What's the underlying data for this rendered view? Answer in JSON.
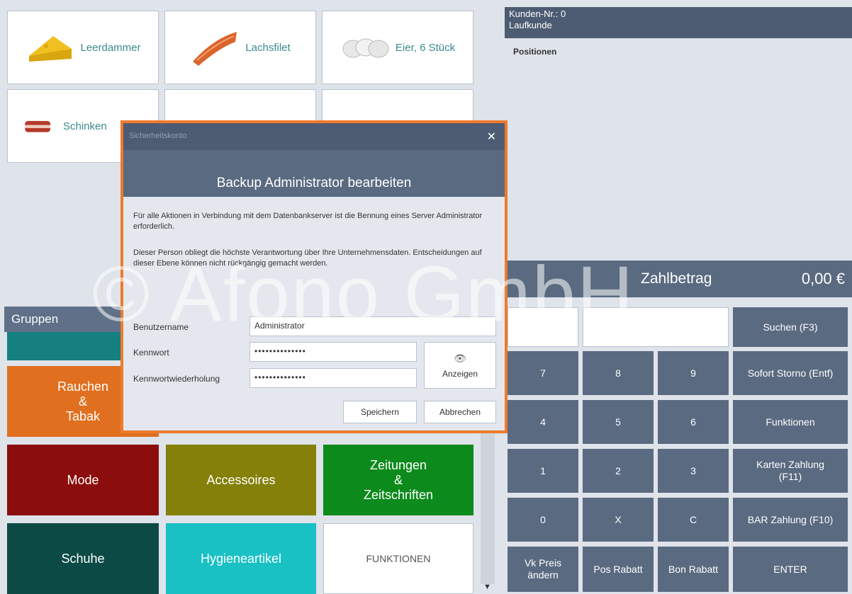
{
  "products": [
    {
      "label": "Leerdammer",
      "icon": "cheese-icon"
    },
    {
      "label": "Lachsfilet",
      "icon": "salmon-icon"
    },
    {
      "label": "Eier, 6 Stück",
      "icon": "eggs-icon"
    },
    {
      "label": "Schinken",
      "icon": "ham-icon"
    }
  ],
  "groups": {
    "header": "Gruppen",
    "items": [
      {
        "label": "Rauchen\n&\nTabak",
        "color": "#e06f1f"
      },
      {
        "label": "Mode",
        "color": "#8b0d0d"
      },
      {
        "label": "Accessoires",
        "color": "#848009"
      },
      {
        "label": "Zeitungen\n&\nZeitschriften",
        "color": "#0d8a1c"
      },
      {
        "label": "Schuhe",
        "color": "#0c4a45"
      },
      {
        "label": "Hygieneartikel",
        "color": "#19c0c4"
      },
      {
        "label": "FUNKTIONEN",
        "color": "#ffffff"
      }
    ]
  },
  "customer": {
    "number": "Kunden-Nr.: 0",
    "name": "Laufkunde"
  },
  "positions_title": "Positionen",
  "payment": {
    "label": "Zahlbetrag",
    "amount": "0,00 €"
  },
  "numpad": {
    "search": "Suchen (F3)",
    "storno": "Sofort Storno (Entf)",
    "functions": "Funktionen",
    "card": "Karten Zahlung\n(F11)",
    "cash": "BAR Zahlung (F10)",
    "enter": "ENTER",
    "keys": [
      "7",
      "8",
      "9",
      "4",
      "5",
      "6",
      "1",
      "2",
      "3",
      "0",
      "X",
      "C"
    ],
    "vk_price": "Vk Preis\nändern",
    "pos_discount": "Pos Rabatt",
    "bon_discount": "Bon Rabatt"
  },
  "watermark": "© Afono GmbH",
  "dialog": {
    "title": "Sicherheitskonto",
    "heading": "Backup Administrator bearbeiten",
    "text1": "Für alle Aktionen in Verbindung mit dem Datenbankserver ist die Bennung eines Server Administrator erforderlich.",
    "text2": "Dieser Person obliegt die höchste Verantwortung über Ihre Unternehmensdaten. Entscheidungen auf dieser Ebene können nicht rückgängig gemacht werden.",
    "username_label": "Benutzername",
    "username_value": "Administrator",
    "password_label": "Kennwort",
    "password_value": "••••••••••••••",
    "repeat_label": "Kennwortwiederholung",
    "repeat_value": "••••••••••••••",
    "show_label": "Anzeigen",
    "save_label": "Speichern",
    "cancel_label": "Abbrechen",
    "accent_color": "#ee7a2c"
  }
}
